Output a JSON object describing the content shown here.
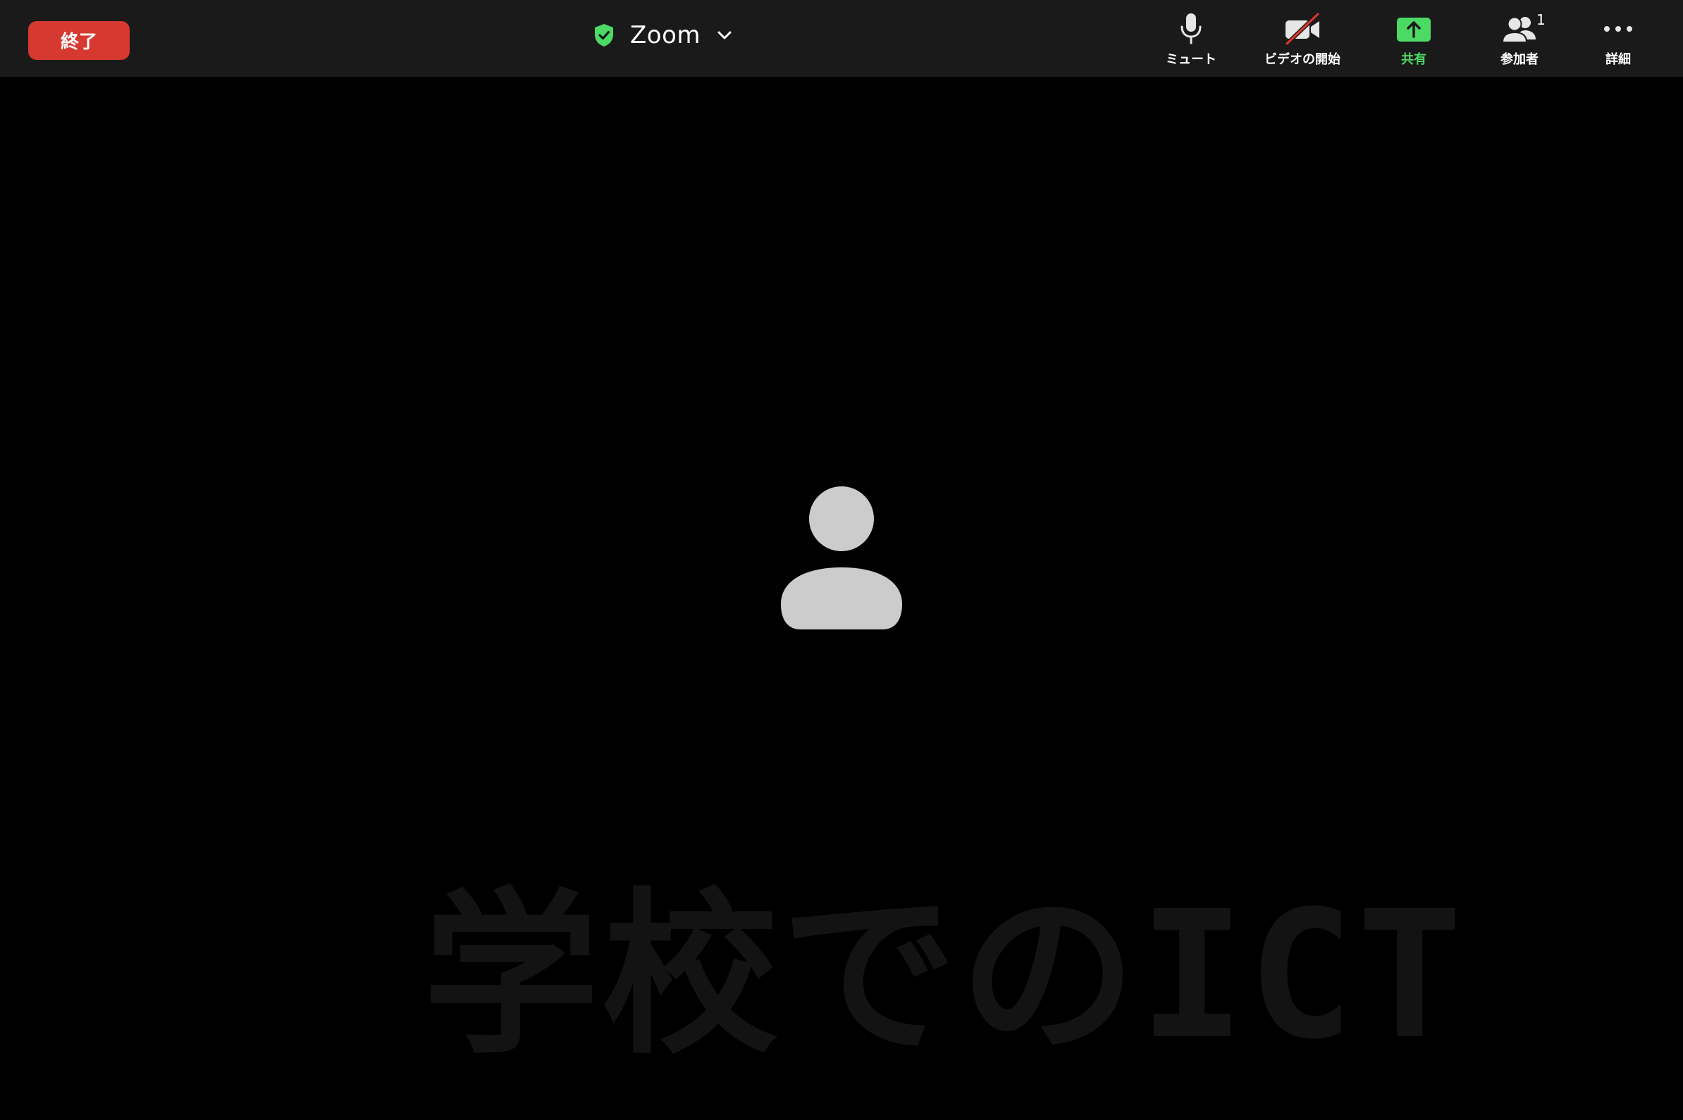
{
  "header": {
    "end_label": "終了",
    "meeting_title": "Zoom",
    "controls": [
      {
        "id": "mute",
        "label": "ミュート",
        "icon": "microphone-icon"
      },
      {
        "id": "video",
        "label": "ビデオの開始",
        "icon": "video-off-icon"
      },
      {
        "id": "share",
        "label": "共有",
        "icon": "share-screen-icon"
      },
      {
        "id": "participants",
        "label": "参加者",
        "icon": "participants-icon",
        "badge": "1"
      },
      {
        "id": "more",
        "label": "詳細",
        "icon": "more-icon"
      }
    ]
  },
  "stage": {
    "avatar_icon": "person-placeholder-icon",
    "watermark_text": "学校でのICT"
  },
  "colors": {
    "topbar_bg": "#1a1a1a",
    "end_button": "#d6392f",
    "share_accent": "#4cd964",
    "shield_green": "#4cd964",
    "avatar": "#cccccc",
    "video_off_slash": "#e0352b"
  }
}
